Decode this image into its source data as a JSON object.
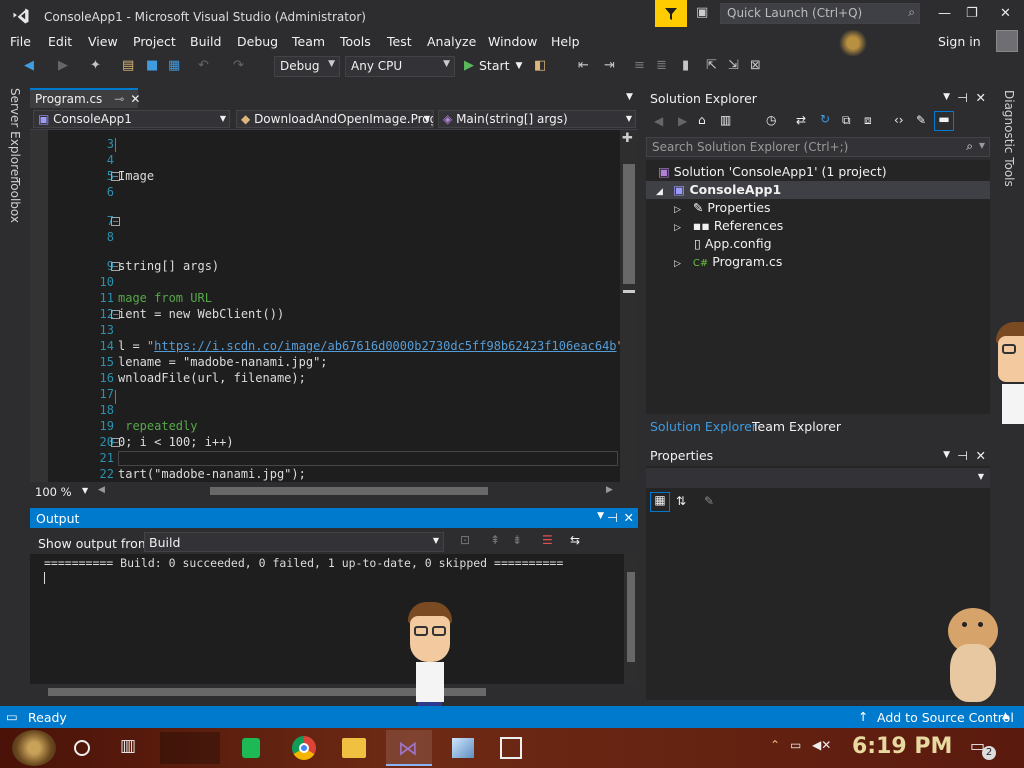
{
  "window": {
    "title": "ConsoleApp1 - Microsoft Visual Studio  (Administrator)",
    "quick_launch_placeholder": "Quick Launch (Ctrl+Q)"
  },
  "menu": {
    "items": [
      "File",
      "Edit",
      "View",
      "Project",
      "Build",
      "Debug",
      "Team",
      "Tools",
      "Test",
      "Analyze",
      "Window",
      "Help"
    ],
    "sign_in": "Sign in"
  },
  "toolbar": {
    "config": "Debug",
    "platform": "Any CPU",
    "start": "Start"
  },
  "side_strip": {
    "items": [
      "Server Explorer",
      "Toolbox"
    ]
  },
  "right_strip": {
    "items": [
      "Diagnostic Tools"
    ]
  },
  "editor": {
    "tab": "Program.cs",
    "nav": {
      "project": "ConsoleApp1",
      "class": "DownloadAndOpenImage.Prog",
      "member": "Main(string[] args)"
    },
    "zoom": "100 %",
    "lines": [
      {
        "n": "3",
        "text": ""
      },
      {
        "n": "4",
        "text": ""
      },
      {
        "n": "5",
        "text": "Image"
      },
      {
        "n": "6",
        "text": ""
      },
      {
        "n": "7",
        "text": ""
      },
      {
        "n": "8",
        "text": ""
      },
      {
        "n": "9",
        "text": "string[] args)"
      },
      {
        "n": "10",
        "text": ""
      },
      {
        "n": "11",
        "text": "mage from URL"
      },
      {
        "n": "12",
        "text": "ient = new WebClient())"
      },
      {
        "n": "13",
        "text": ""
      },
      {
        "n": "14",
        "text": "l = \"https://i.scdn.co/image/ab67616d0000b2730dc5ff98b62423f106eac64b\";"
      },
      {
        "n": "15",
        "text": "lename = \"madobe-nanami.jpg\";"
      },
      {
        "n": "16",
        "text": "wnloadFile(url, filename);"
      },
      {
        "n": "17",
        "text": ""
      },
      {
        "n": "18",
        "text": ""
      },
      {
        "n": "19",
        "text": " repeatedly"
      },
      {
        "n": "20",
        "text": "0; i < 100; i++)"
      },
      {
        "n": "21",
        "text": ""
      },
      {
        "n": "22",
        "text": "tart(\"madobe-nanami.jpg\");"
      }
    ],
    "url": "https://i.scdn.co/image/ab67616d0000b2730dc5ff98b62423f106eac64b"
  },
  "output": {
    "title": "Output",
    "show_from_label": "Show output from:",
    "source": "Build",
    "text": "========== Build: 0 succeeded, 0 failed, 1 up-to-date, 0 skipped =========="
  },
  "solution_explorer": {
    "title": "Solution Explorer",
    "search_placeholder": "Search Solution Explorer (Ctrl+;)",
    "solution": "Solution 'ConsoleApp1' (1 project)",
    "project": "ConsoleApp1",
    "items": [
      "Properties",
      "References",
      "App.config",
      "Program.cs"
    ],
    "tabs": [
      "Solution Explorer",
      "Team Explorer"
    ]
  },
  "properties": {
    "title": "Properties"
  },
  "status": {
    "left": "Ready",
    "right": "Add to Source Control"
  },
  "taskbar": {
    "time": "6:19 PM",
    "notifications": "2"
  },
  "colors": {
    "accent": "#007acc",
    "editor_bg": "#1e1e1e",
    "chrome_bg": "#2d2d30"
  }
}
